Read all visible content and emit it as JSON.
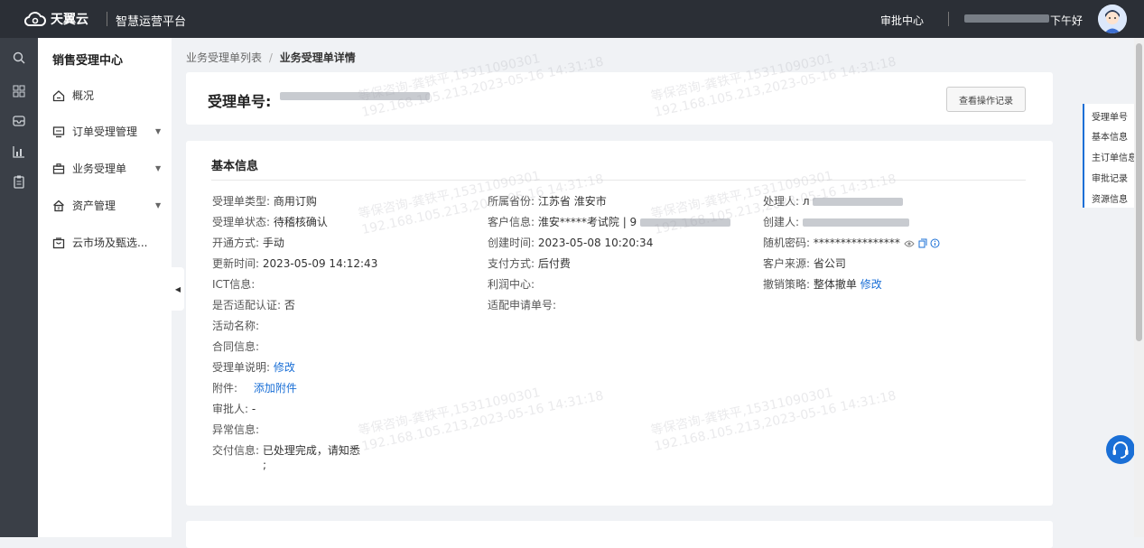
{
  "header": {
    "brand": "天翼云",
    "platform": "智慧运营平台",
    "approval_center": "审批中心",
    "greeting": "下午好"
  },
  "sidebar": {
    "title": "销售受理中心",
    "items": [
      {
        "label": "概况"
      },
      {
        "label": "订单受理管理"
      },
      {
        "label": "业务受理单"
      },
      {
        "label": "资产管理"
      },
      {
        "label": "云市场及甄选..."
      }
    ]
  },
  "breadcrumb": {
    "parent": "业务受理单列表",
    "separator": "/",
    "current": "业务受理单详情"
  },
  "order": {
    "label": "受理单号:",
    "view_log_button": "查看操作记录"
  },
  "basic": {
    "title": "基本信息",
    "col1": [
      {
        "k": "受理单类型:",
        "v": "商用订购"
      },
      {
        "k": "受理单状态:",
        "v": "待稽核确认"
      },
      {
        "k": "开通方式:",
        "v": "手动"
      },
      {
        "k": "更新时间:",
        "v": "2023-05-09 14:12:43"
      },
      {
        "k": "ICT信息:",
        "v": ""
      },
      {
        "k": "是否适配认证:",
        "v": "否"
      },
      {
        "k": "活动名称:",
        "v": ""
      },
      {
        "k": "合同信息:",
        "v": ""
      },
      {
        "k": "受理单说明:",
        "v": "修改"
      },
      {
        "k": "附件:",
        "v": "添加附件"
      },
      {
        "k": "审批人:",
        "v": "-"
      },
      {
        "k": "异常信息:",
        "v": ""
      },
      {
        "k": "交付信息:",
        "v": "已处理完成，请知悉",
        "v2": ";"
      }
    ],
    "col2": [
      {
        "k": "所属省份:",
        "v": "江苏省 淮安市"
      },
      {
        "k": "客户信息:",
        "v": "淮安*****考试院 | 9"
      },
      {
        "k": "创建时间:",
        "v": "2023-05-08 10:20:34"
      },
      {
        "k": "支付方式:",
        "v": "后付费"
      },
      {
        "k": "利润中心:",
        "v": ""
      },
      {
        "k": "适配申请单号:",
        "v": ""
      }
    ],
    "col3": [
      {
        "k": "处理人:",
        "v": "л"
      },
      {
        "k": "创建人:",
        "v": ""
      },
      {
        "k": "随机密码:",
        "v": "****************"
      },
      {
        "k": "客户来源:",
        "v": "省公司"
      },
      {
        "k": "撤销策略:",
        "v": "整体撤单",
        "link": "修改"
      }
    ]
  },
  "anchors": [
    "受理单号",
    "基本信息",
    "主订单信息",
    "审批记录",
    "资源信息"
  ],
  "watermark": {
    "line1": "等保咨询-龚铁平,15311090301",
    "line2": "192.168.105.213,2023-05-16 14:31:18"
  },
  "colors": {
    "accent": "#1a6fd6",
    "topbar": "#2b2f36",
    "rail": "#3a3f47"
  }
}
